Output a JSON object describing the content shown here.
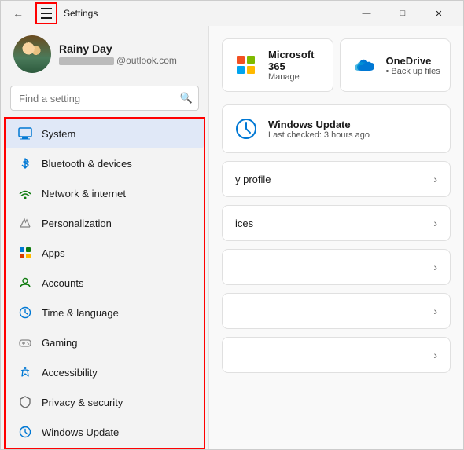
{
  "window": {
    "title": "Settings",
    "controls": {
      "minimize": "—",
      "maximize": "□",
      "close": "✕"
    }
  },
  "sidebar": {
    "user": {
      "name": "Rainy Day",
      "email": "@outlook.com"
    },
    "search": {
      "placeholder": "Find a setting"
    },
    "nav_items": [
      {
        "id": "system",
        "label": "System",
        "icon": "💻",
        "active": true
      },
      {
        "id": "bluetooth",
        "label": "Bluetooth & devices",
        "icon": "bluetooth"
      },
      {
        "id": "network",
        "label": "Network & internet",
        "icon": "wifi"
      },
      {
        "id": "personalization",
        "label": "Personalization",
        "icon": "paint"
      },
      {
        "id": "apps",
        "label": "Apps",
        "icon": "apps"
      },
      {
        "id": "accounts",
        "label": "Accounts",
        "icon": "person"
      },
      {
        "id": "time",
        "label": "Time & language",
        "icon": "clock"
      },
      {
        "id": "gaming",
        "label": "Gaming",
        "icon": "gaming"
      },
      {
        "id": "accessibility",
        "label": "Accessibility",
        "icon": "accessibility"
      },
      {
        "id": "privacy",
        "label": "Privacy & security",
        "icon": "shield"
      },
      {
        "id": "update",
        "label": "Windows Update",
        "icon": "update"
      }
    ]
  },
  "main": {
    "quick_cards": [
      {
        "id": "microsoft365",
        "title": "Microsoft 365",
        "subtitle": "Manage"
      },
      {
        "id": "onedrive",
        "title": "OneDrive",
        "subtitle": "• Back up files"
      }
    ],
    "update_card": {
      "title": "Windows Update",
      "subtitle": "Last checked: 3 hours ago"
    },
    "setting_rows": [
      {
        "id": "profile",
        "label": "y profile"
      },
      {
        "id": "devices",
        "label": "ices"
      },
      {
        "id": "row3",
        "label": ""
      },
      {
        "id": "row4",
        "label": ""
      },
      {
        "id": "row5",
        "label": ""
      }
    ]
  }
}
